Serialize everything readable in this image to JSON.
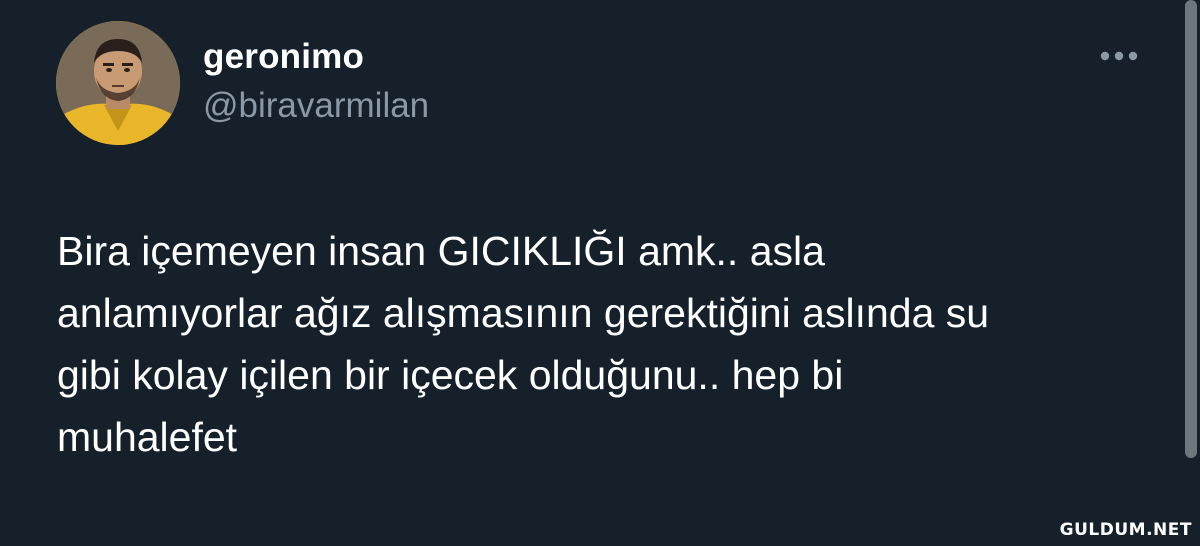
{
  "tweet": {
    "author": {
      "display_name": "geronimo",
      "handle": "@biravarmilan",
      "avatar_icon": "profile-photo"
    },
    "more_icon": "more-horizontal-icon",
    "text": "Bira içemeyen insan GICIKLIĞI amk.. asla\nanlamıyorlar ağız alışmasının gerektiğini aslında su\ngibi kolay içilen bir içecek olduğunu.. hep bi\nmuhalefet"
  },
  "watermark": "GULDUM.NET",
  "colors": {
    "background": "#15202b",
    "primary_text": "#ffffff",
    "secondary_text": "#8b98a5",
    "icon": "#8b98a5"
  }
}
